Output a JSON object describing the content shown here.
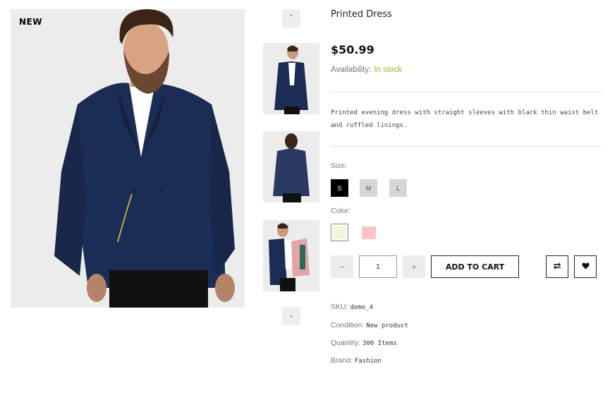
{
  "gallery": {
    "badge": "NEW",
    "up_arrow": "^",
    "down_arrow": "v"
  },
  "product": {
    "title": "Printed Dress",
    "price": "$50.99",
    "availability_label": "Availability:",
    "availability_value": "In stock",
    "description": "Printed evening dress with straight sleeves with black thin waist belt and ruffled linings."
  },
  "options": {
    "size_label": "Size:",
    "sizes": [
      "S",
      "M",
      "L"
    ],
    "selected_size": "S",
    "color_label": "Color:",
    "colors": [
      "#f4f4dc",
      "#ffc2c7"
    ]
  },
  "cart": {
    "minus": "−",
    "quantity": "1",
    "plus": "+",
    "add_label": "ADD TO CART",
    "compare_icon": "compare-icon",
    "wishlist_icon": "heart-icon"
  },
  "meta": {
    "sku_label": "SKU:",
    "sku": "demo_4",
    "condition_label": "Condition:",
    "condition": "New product",
    "quantity_label": "Quantity:",
    "quantity": "300 Items",
    "brand_label": "Brand:",
    "brand": "Fashion"
  },
  "colors": {
    "accent_instock": "#9bbd1a",
    "jacket": "#1c2d55"
  }
}
